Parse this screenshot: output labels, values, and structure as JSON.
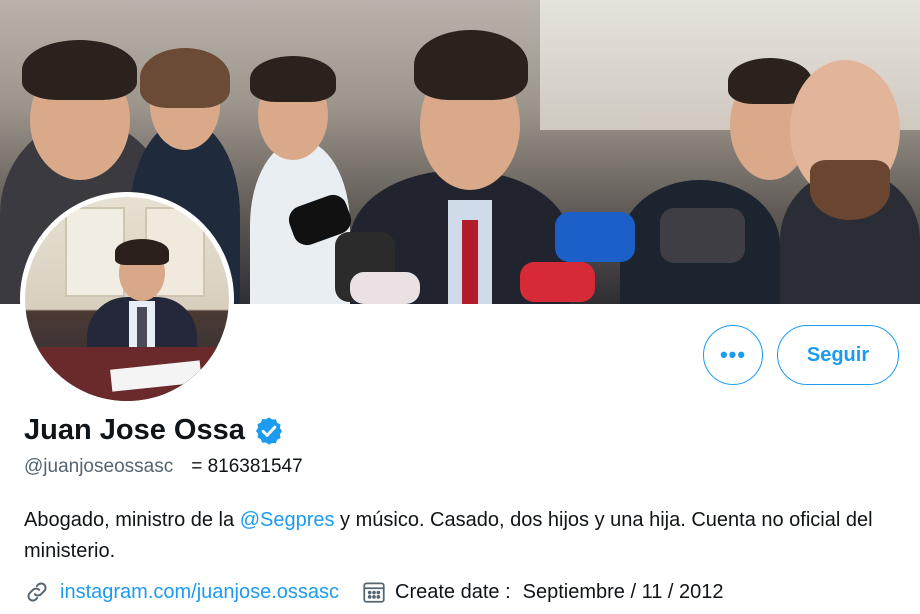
{
  "profile": {
    "display_name": "Juan Jose Ossa",
    "handle": "@juanjoseossasc",
    "user_id": "= 816381547",
    "bio": {
      "part1": "Abogado, ministro de la ",
      "mention": "@Segpres",
      "part2": " y músico. Casado, dos hijos y una hija. Cuenta no oficial del ministerio."
    },
    "link": "instagram.com/juanjose.ossasc",
    "create_label": "Create date :",
    "create_value": "Septiembre / 11 / 2012"
  },
  "actions": {
    "more_label": "•••",
    "follow_label": "Seguir"
  },
  "icons": {
    "verified": "verified-badge-icon",
    "link": "link-icon",
    "calendar": "calendar-icon"
  },
  "colors": {
    "accent": "#1d9bf0",
    "text": "#0f1419",
    "secondary": "#536471"
  }
}
